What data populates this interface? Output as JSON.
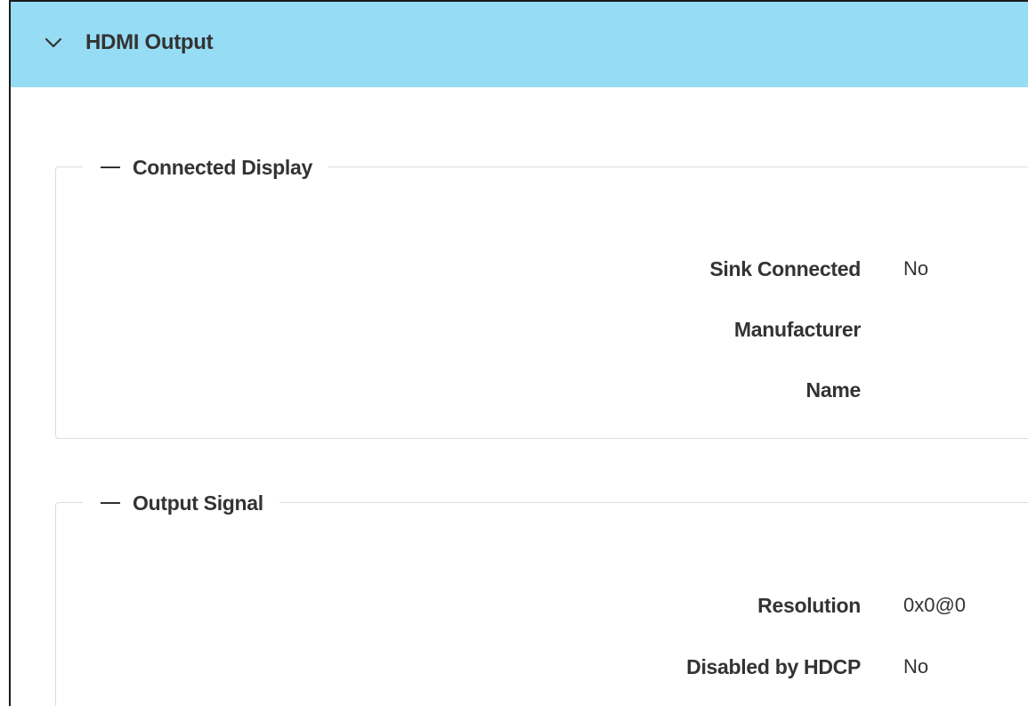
{
  "panel": {
    "title": "HDMI Output",
    "expanded_icon": "chevron-down-icon",
    "header_color": "#96dcf5"
  },
  "connected_display": {
    "legend": "Connected Display",
    "collapse_icon": "minus-icon",
    "fields": [
      {
        "label": "Sink Connected",
        "value": "No"
      },
      {
        "label": "Manufacturer",
        "value": ""
      },
      {
        "label": "Name",
        "value": ""
      }
    ]
  },
  "output_signal": {
    "legend": "Output Signal",
    "collapse_icon": "minus-icon",
    "fields": [
      {
        "label": "Resolution",
        "value": "0x0@0"
      },
      {
        "label": "Disabled by HDCP",
        "value": "No"
      }
    ]
  }
}
